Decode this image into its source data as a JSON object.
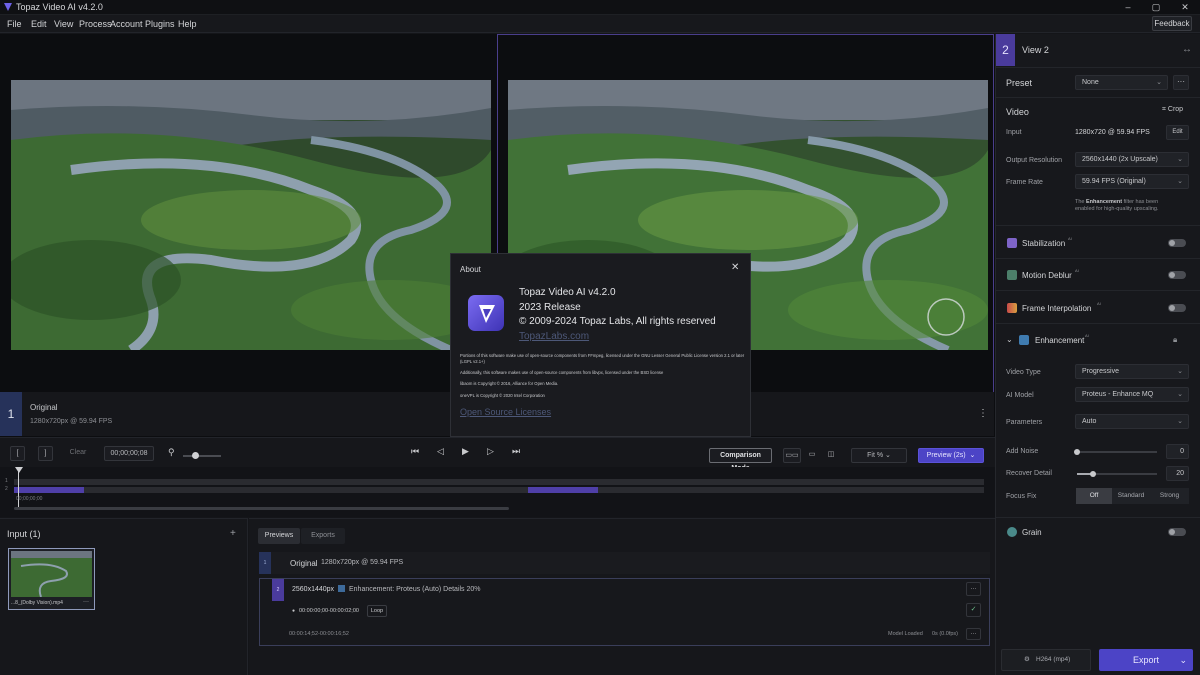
{
  "window": {
    "title": "Topaz Video AI  v4.2.0",
    "controls": [
      "–",
      "▢",
      "✕"
    ]
  },
  "menu": [
    "File",
    "Edit",
    "View",
    "Process",
    "Account",
    "Plugins",
    "Help"
  ],
  "feedback_label": "Feedback",
  "viewer": {
    "original": {
      "badge": "1",
      "name": "Original",
      "sub": "1280x720px @ 59.94 FPS"
    }
  },
  "controls": {
    "in_mark": "[",
    "out_mark": "]",
    "clear_label": "Clear",
    "timecode": "00;00;00;08",
    "comparison_mode_label": "Comparison Mode",
    "fit_label": "Fit %",
    "preview_label": "Preview (2s)"
  },
  "timeline": {
    "track1": "1",
    "track2": "2",
    "start_time": "00;00;00;00"
  },
  "input_panel": {
    "title": "Input (1)",
    "add_icon": "+",
    "file_name": "...8_(Dolby Vision).mp4",
    "file_more": "···"
  },
  "previews": {
    "tabs": [
      "Previews",
      "Exports"
    ],
    "original_row": {
      "badge": "1",
      "label": "Original",
      "sub": "1280x720px @ 59.94 FPS"
    },
    "preview_row": {
      "badge": "2",
      "size": "2560x1440px",
      "enhancement": "Enhancement: Proteus (Auto) Details 20%",
      "range": "00:00:00;00-00:00:02;00",
      "loop_label": "Loop",
      "timestamp": "00:00:14;52-00:00:16;52",
      "status": "Model Loaded",
      "fps": "0s (0.0fps)",
      "more": "···"
    }
  },
  "right_panel": {
    "view_badge": "2",
    "view_title": "View 2",
    "preset_label": "Preset",
    "preset_value": "None",
    "video_label": "Video",
    "crop_label": "Crop",
    "input_label": "Input",
    "input_value": "1280x720 @ 59.94 FPS",
    "edit_label": "Edit",
    "output_resolution_label": "Output Resolution",
    "output_resolution_value": "2560x1440 (2x Upscale)",
    "frame_rate_label": "Frame Rate",
    "frame_rate_value": "59.94 FPS (Original)",
    "enhancement_note_pre": "The ",
    "enhancement_note_bold": "Enhancement",
    "enhancement_note_post": " filter has been enabled for high-quality upscaling.",
    "stabilization_label": "Stabilization",
    "motion_deblur_label": "Motion Deblur",
    "frame_interpolation_label": "Frame Interpolation",
    "ai_tag": "AI",
    "enhancement_label": "Enhancement",
    "video_type_label": "Video Type",
    "video_type_value": "Progressive",
    "ai_model_label": "AI Model",
    "ai_model_value": "Proteus - Enhance MQ",
    "parameters_label": "Parameters",
    "parameters_value": "Auto",
    "add_noise_label": "Add Noise",
    "add_noise_value": "0",
    "add_noise_level": 0,
    "recover_detail_label": "Recover Detail",
    "recover_detail_value": "20",
    "recover_detail_level": 0.2,
    "focus_fix_label": "Focus Fix",
    "focus_fix_options": [
      "Off",
      "Standard",
      "Strong"
    ],
    "grain_label": "Grain",
    "codec_label": "H264 (mp4)",
    "export_label": "Export"
  },
  "about_dialog": {
    "title": "About",
    "app_name": "Topaz Video AI  v4.2.0",
    "release": "2023 Release",
    "copyright": "© 2009-2024 Topaz Labs, All rights reserved",
    "website": "TopazLabs.com",
    "notice1": "Portions of this software make use of open-source components from FFmpeg, licensed under the GNU Lesser General Public License version 2.1 or later (LGPL v2.1+)",
    "notice2": "Additionally, this software makes use of open-source components from libvpx, licensed under the BSD license",
    "notice3": "libaom is Copyright © 2016, Alliance for Open Media.",
    "notice4": "oneVPL is Copyright © 2020 Intel Corporation",
    "licenses_link": "Open Source Licenses"
  },
  "colors": {
    "accent": "#5b4fd4",
    "badge_blue": "#26325a",
    "track_purple": "#4f3fa8"
  }
}
